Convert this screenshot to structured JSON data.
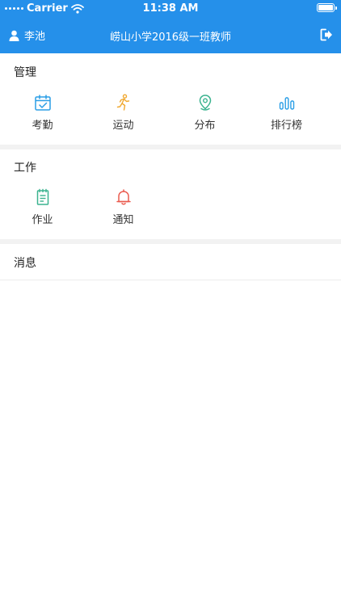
{
  "status_bar": {
    "carrier": "Carrier",
    "time": "11:38 AM"
  },
  "nav": {
    "user_name": "李池",
    "title": "崂山小学2016级一班教师"
  },
  "sections": {
    "management": {
      "title": "管理",
      "items": [
        {
          "label": "考勤",
          "icon": "calendar-check-icon",
          "color": "#2a9ee6"
        },
        {
          "label": "运动",
          "icon": "runner-icon",
          "color": "#f0a830"
        },
        {
          "label": "分布",
          "icon": "location-pin-icon",
          "color": "#3bb38f"
        },
        {
          "label": "排行榜",
          "icon": "bar-chart-icon",
          "color": "#2a9ee6"
        }
      ]
    },
    "work": {
      "title": "工作",
      "items": [
        {
          "label": "作业",
          "icon": "notebook-icon",
          "color": "#3bb38f"
        },
        {
          "label": "通知",
          "icon": "bell-icon",
          "color": "#ea5b4f"
        }
      ]
    },
    "messages": {
      "title": "消息"
    }
  },
  "colors": {
    "header": "#2590ea",
    "section_gap": "#f2f2f2"
  }
}
